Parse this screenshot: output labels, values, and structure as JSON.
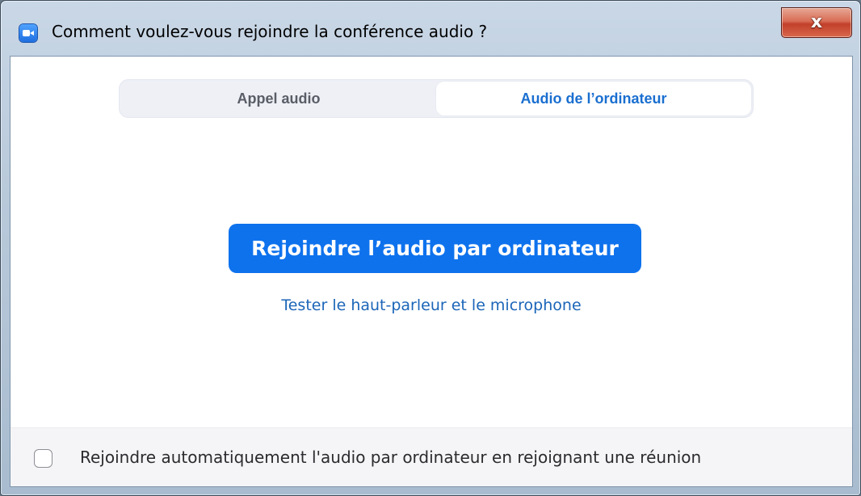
{
  "window": {
    "title": "Comment voulez-vous rejoindre la conférence audio ?",
    "close_label": "x"
  },
  "tabs": [
    {
      "label": "Appel audio",
      "selected": false
    },
    {
      "label": "Audio de l’ordinateur",
      "selected": true
    }
  ],
  "main": {
    "join_button_label": "Rejoindre l’audio par ordinateur",
    "test_link_label": "Tester le haut-parleur et le microphone"
  },
  "footer": {
    "auto_join_label": "Rejoindre automatiquement l'audio par ordinateur en rejoignant une réunion",
    "auto_join_checked": false
  },
  "colors": {
    "accent": "#0e72ed",
    "link": "#1b65b8",
    "active_tab_text": "#1a6fd0"
  },
  "icons": {
    "app": "zoom-camera-icon",
    "close": "close-icon"
  }
}
